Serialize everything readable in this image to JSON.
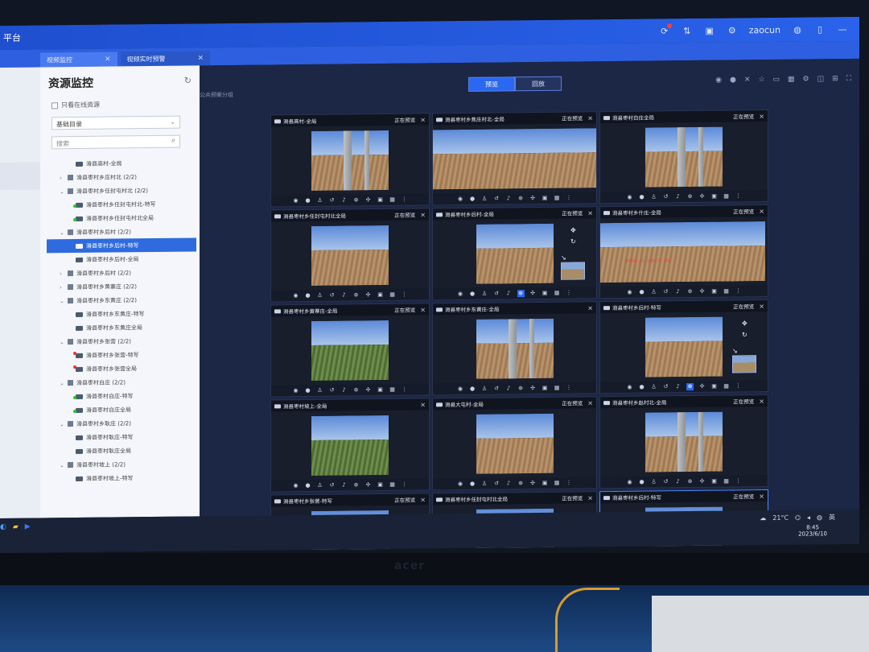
{
  "app": {
    "title": "平台"
  },
  "topbar": {
    "username": "zaocun",
    "notif_badge": "!"
  },
  "tabs": [
    {
      "label": "视频监控",
      "active": true
    },
    {
      "label": "视频实时预警",
      "active": false
    }
  ],
  "panel": {
    "title": "资源监控",
    "online_only": "只看在线资源",
    "directory": "基础目录",
    "search_placeholder": "搜索"
  },
  "tree": [
    {
      "label": "滑县高村-全局",
      "indent": 2,
      "icon": "cam"
    },
    {
      "label": "滑县枣村乡庄村北 (2/2)",
      "indent": 1,
      "icon": "org",
      "arrow": "›"
    },
    {
      "label": "滑县枣村乡任封屯村北 (2/2)",
      "indent": 1,
      "icon": "org",
      "arrow": "⌄"
    },
    {
      "label": "滑县枣村乡任封屯村北-特写",
      "indent": 2,
      "icon": "cam-grn"
    },
    {
      "label": "滑县枣村乡任封屯村北全局",
      "indent": 2,
      "icon": "cam-grn"
    },
    {
      "label": "滑县枣村乡后村 (2/2)",
      "indent": 1,
      "icon": "org",
      "arrow": "⌄"
    },
    {
      "label": "滑县枣村乡后村-特写",
      "indent": 2,
      "icon": "cam",
      "selected": true
    },
    {
      "label": "滑县枣村乡后村-全局",
      "indent": 2,
      "icon": "cam"
    },
    {
      "label": "滑县枣村乡后村 (2/2)",
      "indent": 1,
      "icon": "org",
      "arrow": "›"
    },
    {
      "label": "滑县枣村乡黄寨庄 (2/2)",
      "indent": 1,
      "icon": "org",
      "arrow": "›"
    },
    {
      "label": "滑县枣村乡东黄庄 (2/2)",
      "indent": 1,
      "icon": "org",
      "arrow": "⌄"
    },
    {
      "label": "滑县枣村乡东黄庄-特写",
      "indent": 2,
      "icon": "cam"
    },
    {
      "label": "滑县枣村乡东黄庄全局",
      "indent": 2,
      "icon": "cam"
    },
    {
      "label": "滑县枣村乡张营 (2/2)",
      "indent": 1,
      "icon": "org",
      "arrow": "⌄"
    },
    {
      "label": "滑县枣村乡张营-特写",
      "indent": 2,
      "icon": "cam-red"
    },
    {
      "label": "滑县枣村乡张营全局",
      "indent": 2,
      "icon": "cam-red"
    },
    {
      "label": "滑县枣村白庄 (2/2)",
      "indent": 1,
      "icon": "org",
      "arrow": "⌄"
    },
    {
      "label": "滑县枣村白庄-特写",
      "indent": 2,
      "icon": "cam-grn"
    },
    {
      "label": "滑县枣村白庄全局",
      "indent": 2,
      "icon": "cam-grn"
    },
    {
      "label": "滑县枣村乡耿庄 (2/2)",
      "indent": 1,
      "icon": "org",
      "arrow": "⌄"
    },
    {
      "label": "滑县枣村耿庄-特写",
      "indent": 2,
      "icon": "cam"
    },
    {
      "label": "滑县枣村耿庄全局",
      "indent": 2,
      "icon": "cam"
    },
    {
      "label": "滑县枣村坡上 (2/2)",
      "indent": 1,
      "icon": "org",
      "arrow": "⌄"
    },
    {
      "label": "滑县枣村坡上-特写",
      "indent": 2,
      "icon": "cam"
    }
  ],
  "main": {
    "group_label": "公共预案分组",
    "preview_btn": "预览",
    "playback_btn": "回放"
  },
  "cells": [
    {
      "name": "滑县高村-全局",
      "status": "正在预览",
      "scene": "pole"
    },
    {
      "name": "滑县枣村乡焦庄村北-全局",
      "status": "正在预览",
      "scene": "wide"
    },
    {
      "name": "滑县枣村白庄全局",
      "status": "正在预览",
      "scene": "pole"
    },
    {
      "name": "滑县枣村乡任封屯村北全局",
      "status": "正在预览",
      "scene": "field"
    },
    {
      "name": "滑县枣村乡后村-全局",
      "status": "正在预览",
      "scene": "field",
      "ptz": true,
      "zoom_on": true
    },
    {
      "name": "滑县枣村乡什庄-全局",
      "status": "正在预览",
      "scene": "wide"
    },
    {
      "name": "滑县枣村乡黄寨庄-全局",
      "status": "正在预览",
      "scene": "green"
    },
    {
      "name": "滑县枣村乡东黄庄-全局",
      "status": "",
      "scene": "pole"
    },
    {
      "name": "滑县枣村乡后村-特写",
      "status": "正在预览",
      "scene": "field",
      "ptz": true,
      "zoom_on": true
    },
    {
      "name": "滑县枣村坡上-全局",
      "status": "",
      "scene": "green"
    },
    {
      "name": "滑县大屯村-全局",
      "status": "正在预览",
      "scene": "field"
    },
    {
      "name": "滑县枣村乡赵村北-全局",
      "status": "正在预览",
      "scene": "pole"
    },
    {
      "name": "滑县枣村乡张营-特写",
      "status": "正在预览",
      "scene": "field"
    },
    {
      "name": "滑县枣村乡任封屯村北全局",
      "status": "正在预览",
      "scene": "field"
    },
    {
      "name": "滑县枣村乡后村-特写",
      "status": "正在预览",
      "scene": "field",
      "selected": true
    }
  ],
  "osd": {
    "ip": "IP地址:41.100.79.105"
  },
  "tray": {
    "weather": "21°C",
    "lang": "英",
    "time": "8:45",
    "date": "2023/6/10"
  },
  "brand": "acer"
}
